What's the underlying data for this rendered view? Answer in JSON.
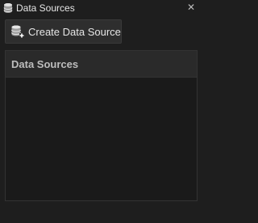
{
  "window": {
    "title": "Data Sources",
    "close_glyph": "✕",
    "title_icon": "database-icon",
    "close_icon": "close-icon"
  },
  "toolbar": {
    "create_label": "Create Data Source",
    "create_icon": "add-database-icon"
  },
  "list": {
    "header": "Data Sources",
    "items": []
  }
}
